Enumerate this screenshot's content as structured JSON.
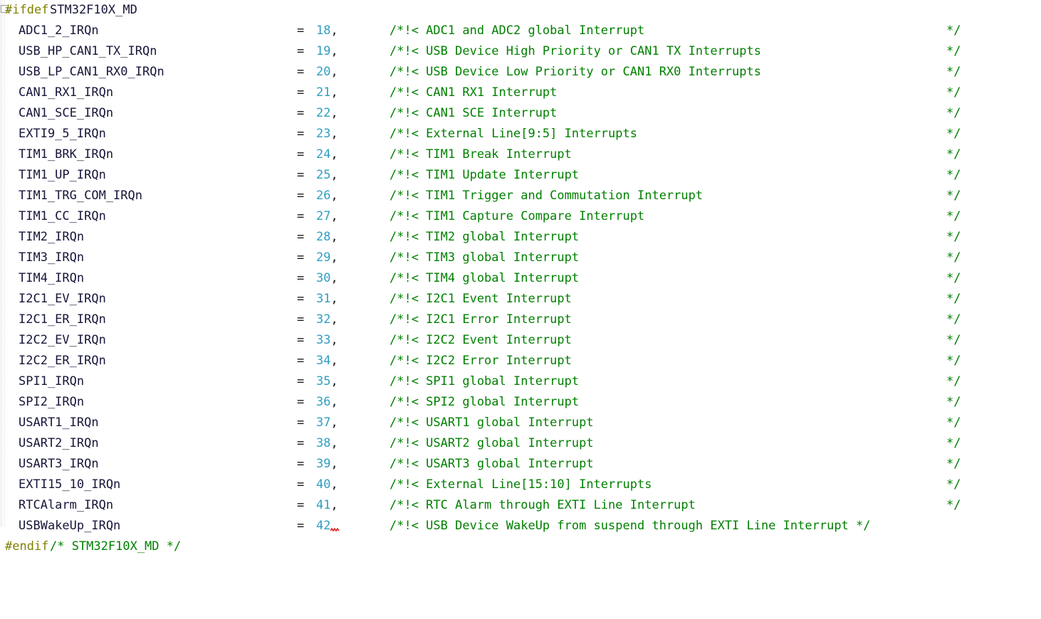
{
  "editor": {
    "language": "C",
    "font_size_px": 17,
    "line_height_px": 29,
    "colors": {
      "background": "#ffffff",
      "preprocessor": "#808000",
      "identifier": "#16163a",
      "number": "#2f9fc0",
      "comment": "#008000",
      "punctuation": "#1a1a1a",
      "error_squiggle": "#e02020",
      "gutter": "#f2f2f2"
    }
  },
  "directive_open": {
    "keyword": "#ifdef",
    "macro": "STM32F10X_MD",
    "fold_marker": "collapse-box-icon"
  },
  "directive_close": {
    "keyword": "#endif",
    "comment": "/* STM32F10X_MD */"
  },
  "separator": "=",
  "comma": ",",
  "comment_end": "*/",
  "enumerators": [
    {
      "name": "ADC1_2_IRQn",
      "value": "18",
      "comment": "/*!< ADC1 and ADC2 global Interrupt",
      "comment_terminated_inline": false,
      "error": false
    },
    {
      "name": "USB_HP_CAN1_TX_IRQn",
      "value": "19",
      "comment": "/*!< USB Device High Priority or CAN1 TX Interrupts",
      "comment_terminated_inline": false,
      "error": false
    },
    {
      "name": "USB_LP_CAN1_RX0_IRQn",
      "value": "20",
      "comment": "/*!< USB Device Low Priority or CAN1 RX0 Interrupts",
      "comment_terminated_inline": false,
      "error": false
    },
    {
      "name": "CAN1_RX1_IRQn",
      "value": "21",
      "comment": "/*!< CAN1 RX1 Interrupt",
      "comment_terminated_inline": false,
      "error": false
    },
    {
      "name": "CAN1_SCE_IRQn",
      "value": "22",
      "comment": "/*!< CAN1 SCE Interrupt",
      "comment_terminated_inline": false,
      "error": false
    },
    {
      "name": "EXTI9_5_IRQn",
      "value": "23",
      "comment": "/*!< External Line[9:5] Interrupts",
      "comment_terminated_inline": false,
      "error": false
    },
    {
      "name": "TIM1_BRK_IRQn",
      "value": "24",
      "comment": "/*!< TIM1 Break Interrupt",
      "comment_terminated_inline": false,
      "error": false
    },
    {
      "name": "TIM1_UP_IRQn",
      "value": "25",
      "comment": "/*!< TIM1 Update Interrupt",
      "comment_terminated_inline": false,
      "error": false
    },
    {
      "name": "TIM1_TRG_COM_IRQn",
      "value": "26",
      "comment": "/*!< TIM1 Trigger and Commutation Interrupt",
      "comment_terminated_inline": false,
      "error": false
    },
    {
      "name": "TIM1_CC_IRQn",
      "value": "27",
      "comment": "/*!< TIM1 Capture Compare Interrupt",
      "comment_terminated_inline": false,
      "error": false
    },
    {
      "name": "TIM2_IRQn",
      "value": "28",
      "comment": "/*!< TIM2 global Interrupt",
      "comment_terminated_inline": false,
      "error": false
    },
    {
      "name": "TIM3_IRQn",
      "value": "29",
      "comment": "/*!< TIM3 global Interrupt",
      "comment_terminated_inline": false,
      "error": false
    },
    {
      "name": "TIM4_IRQn",
      "value": "30",
      "comment": "/*!< TIM4 global Interrupt",
      "comment_terminated_inline": false,
      "error": false
    },
    {
      "name": "I2C1_EV_IRQn",
      "value": "31",
      "comment": "/*!< I2C1 Event Interrupt",
      "comment_terminated_inline": false,
      "error": false
    },
    {
      "name": "I2C1_ER_IRQn",
      "value": "32",
      "comment": "/*!< I2C1 Error Interrupt",
      "comment_terminated_inline": false,
      "error": false
    },
    {
      "name": "I2C2_EV_IRQn",
      "value": "33",
      "comment": "/*!< I2C2 Event Interrupt",
      "comment_terminated_inline": false,
      "error": false
    },
    {
      "name": "I2C2_ER_IRQn",
      "value": "34",
      "comment": "/*!< I2C2 Error Interrupt",
      "comment_terminated_inline": false,
      "error": false
    },
    {
      "name": "SPI1_IRQn",
      "value": "35",
      "comment": "/*!< SPI1 global Interrupt",
      "comment_terminated_inline": false,
      "error": false
    },
    {
      "name": "SPI2_IRQn",
      "value": "36",
      "comment": "/*!< SPI2 global Interrupt",
      "comment_terminated_inline": false,
      "error": false
    },
    {
      "name": "USART1_IRQn",
      "value": "37",
      "comment": "/*!< USART1 global Interrupt",
      "comment_terminated_inline": false,
      "error": false
    },
    {
      "name": "USART2_IRQn",
      "value": "38",
      "comment": "/*!< USART2 global Interrupt",
      "comment_terminated_inline": false,
      "error": false
    },
    {
      "name": "USART3_IRQn",
      "value": "39",
      "comment": "/*!< USART3 global Interrupt",
      "comment_terminated_inline": false,
      "error": false
    },
    {
      "name": "EXTI15_10_IRQn",
      "value": "40",
      "comment": "/*!< External Line[15:10] Interrupts",
      "comment_terminated_inline": false,
      "error": false
    },
    {
      "name": "RTCAlarm_IRQn",
      "value": "41",
      "comment": "/*!< RTC Alarm through EXTI Line Interrupt",
      "comment_terminated_inline": false,
      "error": false
    },
    {
      "name": "USBWakeUp_IRQn",
      "value": "42",
      "comment": "/*!< USB Device WakeUp from suspend through EXTI Line Interrupt */",
      "comment_terminated_inline": true,
      "error": true,
      "error_kind": "missing-comma-squiggle"
    }
  ]
}
